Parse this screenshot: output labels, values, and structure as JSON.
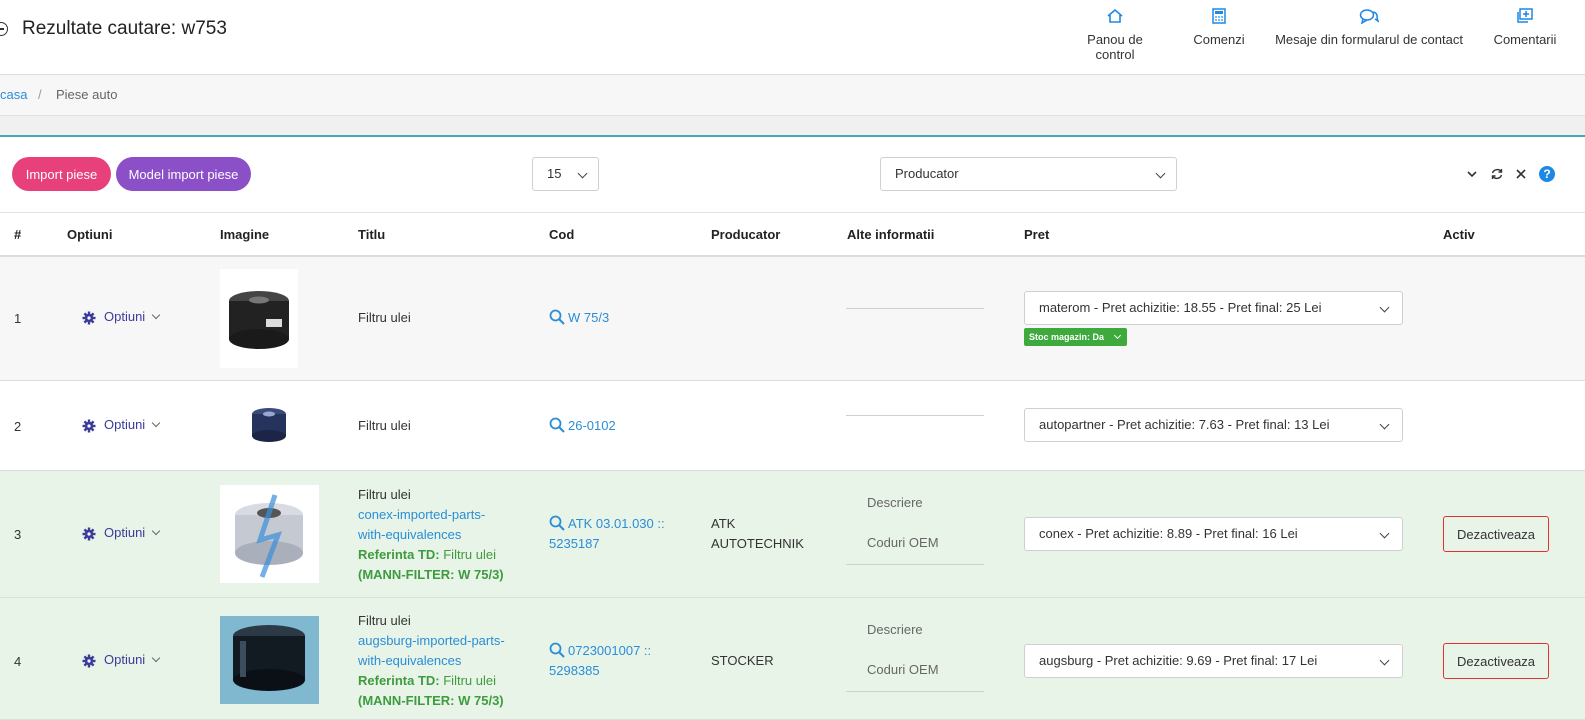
{
  "header": {
    "title": "Rezultate cautare: w753",
    "nav": [
      {
        "label": "Panou de control",
        "icon": "home-icon"
      },
      {
        "label": "Comenzi",
        "icon": "calculator-icon"
      },
      {
        "label": "Mesaje din formularul de contact",
        "icon": "chat-icon"
      },
      {
        "label": "Comentarii",
        "icon": "comment-add-icon"
      }
    ]
  },
  "breadcrumb": {
    "home": "casa",
    "separator": "/",
    "current": "Piese auto"
  },
  "toolbar": {
    "import_label": "Import piese",
    "model_label": "Model import piese",
    "per_page": "15",
    "producator_placeholder": "Producator",
    "help": "?"
  },
  "table": {
    "headers": [
      "#",
      "Optiuni",
      "Imagine",
      "Titlu",
      "Cod",
      "Producator",
      "Alte informatii",
      "Pret",
      "Activ"
    ],
    "option_label": "Optiuni",
    "alt_descriere": "Descriere",
    "alt_coduri": "Coduri OEM",
    "deactivate_label": "Dezactiveaza",
    "rows": [
      {
        "index": "1",
        "title": "Filtru ulei",
        "code_line1": "W 75/3",
        "code_line2": "",
        "producer_line1": "",
        "producer_line2": "",
        "price": "materom - Pret achizitie: 18.55 - Pret final: 25 Lei",
        "stock": "Stoc magazin: Da"
      },
      {
        "index": "2",
        "title": "Filtru ulei",
        "code_line1": "26-0102",
        "code_line2": "",
        "producer_line1": "",
        "producer_line2": "",
        "price": "autopartner - Pret achizitie: 7.63 - Pret final: 13 Lei"
      },
      {
        "index": "3",
        "title": "Filtru ulei",
        "link_line1": "conex-imported-parts-",
        "link_line2": "with-equivalences",
        "ref_label": "Referinta TD:",
        "ref_value": " Filtru ulei",
        "ref_paren": "(MANN-FILTER: W 75/3)",
        "code_line1": "ATK 03.01.030 ::",
        "code_line2": "5235187",
        "producer_line1": "ATK",
        "producer_line2": "AUTOTECHNIK",
        "price": "conex - Pret achizitie: 8.89 - Pret final: 16 Lei"
      },
      {
        "index": "4",
        "title": "Filtru ulei",
        "link_line1": "augsburg-imported-parts-",
        "link_line2": "with-equivalences",
        "ref_label": "Referinta TD:",
        "ref_value": " Filtru ulei",
        "ref_paren": "(MANN-FILTER: W 75/3)",
        "code_line1": "0723001007 ::",
        "code_line2": "5298385",
        "producer_line1": "STOCKER",
        "producer_line2": "",
        "price": "augsburg - Pret achizitie: 9.69 - Pret final: 17 Lei"
      }
    ]
  },
  "colors": {
    "import_button": "#e7407a",
    "model_button": "#8b4fc8",
    "link": "#2a8ed6",
    "stock_badge": "#3eaa3e",
    "deactivate_border": "#dd3333",
    "row_highlight": "#e8f4e8"
  }
}
